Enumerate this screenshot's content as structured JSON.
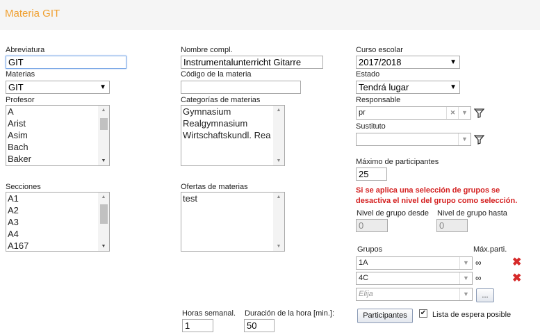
{
  "header": {
    "title": "Materia GIT"
  },
  "abbr": {
    "label": "Abreviatura",
    "value": "GIT"
  },
  "fullname": {
    "label": "Nombre compl.",
    "value": "Instrumentalunterricht Gitarre"
  },
  "schoolyear": {
    "label": "Curso escolar",
    "value": "2017/2018"
  },
  "subjects": {
    "label": "Materias",
    "value": "GIT"
  },
  "subject_code": {
    "label": "Código de la materia",
    "value": ""
  },
  "status": {
    "label": "Estado",
    "value": "Tendrá lugar"
  },
  "teacher": {
    "label": "Profesor",
    "items": [
      "A",
      "Arist",
      "Asim",
      "Bach",
      "Baker"
    ]
  },
  "categories": {
    "label": "Categorías de materias",
    "items": [
      "Gymnasium",
      "Realgymnasium",
      "Wirtschaftskundl. Rea"
    ]
  },
  "responsible": {
    "label": "Responsable",
    "value": "pr"
  },
  "substitute": {
    "label": "Sustituto",
    "value": ""
  },
  "max_participants": {
    "label": "Máximo de participantes",
    "value": "25"
  },
  "warning": {
    "line1": "Si se aplica una selección de grupos se",
    "line2": "desactiva el nivel del grupo como selección."
  },
  "group_level_from": {
    "label": "Nivel de grupo desde",
    "value": "0"
  },
  "group_level_to": {
    "label": "Nivel de grupo hasta",
    "value": "0"
  },
  "sections": {
    "label": "Secciones",
    "items": [
      "A1",
      "A2",
      "A3",
      "A4",
      "A167"
    ]
  },
  "offers": {
    "label": "Ofertas de materias",
    "items": [
      "test"
    ]
  },
  "groups": {
    "label": "Grupos",
    "max_label": "Máx.parti.",
    "rows": [
      {
        "name": "1A",
        "max": "∞"
      },
      {
        "name": "4C",
        "max": "∞"
      }
    ],
    "choose_placeholder": "Elija",
    "more_label": "..."
  },
  "weekly_hours": {
    "label": "Horas semanal.",
    "value": "1"
  },
  "hour_duration": {
    "label": "Duración de la hora [min.]:",
    "value": "50"
  },
  "participants_button": "Participantes",
  "waitlist": {
    "label": "Lista de espera posible",
    "checked": true
  },
  "icons": {
    "filter": "filter-icon",
    "clear": "clear-icon",
    "dropdown": "chevron-down-icon",
    "delete": "delete-icon"
  },
  "colors": {
    "title": "#f0a030",
    "warning": "#d42020",
    "delete": "#d62a2a"
  }
}
